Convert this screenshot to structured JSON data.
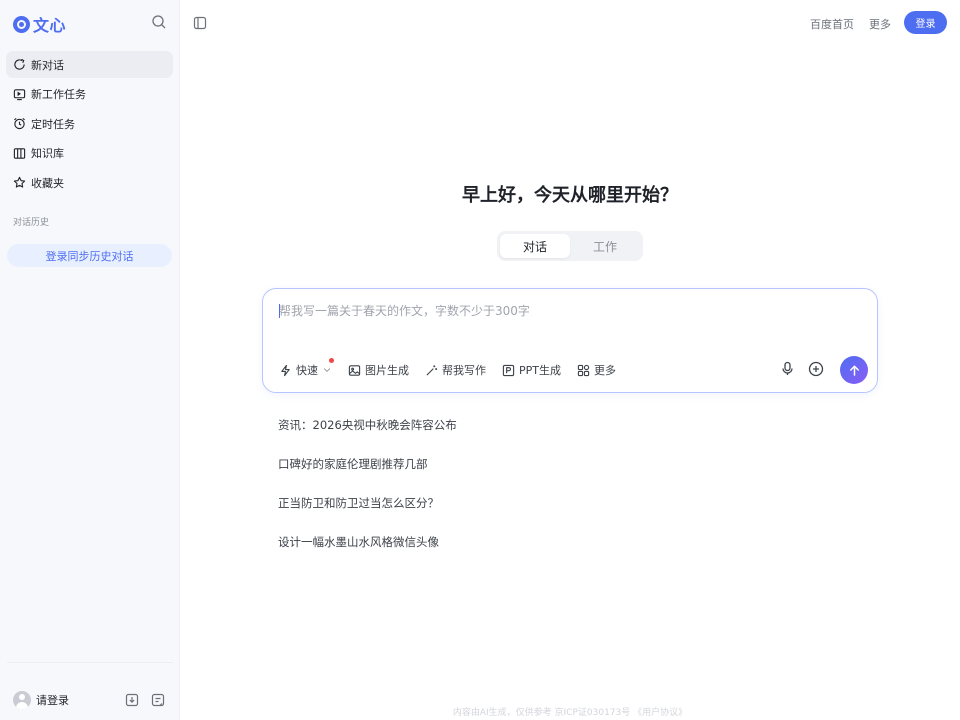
{
  "sidebar": {
    "logo_text": "文心",
    "menu": [
      {
        "label": "新对话",
        "icon": "new-chat-icon",
        "active": true
      },
      {
        "label": "新工作任务",
        "icon": "task-icon",
        "active": false
      },
      {
        "label": "定时任务",
        "icon": "alarm-clock-icon",
        "active": false
      },
      {
        "label": "知识库",
        "icon": "library-icon",
        "active": false
      },
      {
        "label": "收藏夹",
        "icon": "star-icon",
        "active": false
      }
    ],
    "history_label": "对话历史",
    "sync_button": "登录同步历史对话",
    "login_text": "请登录"
  },
  "header": {
    "links": [
      "百度首页",
      "更多"
    ],
    "login_button": "登录"
  },
  "main": {
    "greeting": "早上好，今天从哪里开始？",
    "modes": [
      "对话",
      "工作"
    ],
    "active_mode": "对话",
    "input_placeholder": "帮我写一篇关于春天的作文，字数不少于300字",
    "tools": [
      "快速",
      "图片生成",
      "帮我写作",
      "PPT生成",
      "更多"
    ],
    "suggestions": [
      "资讯：2026央视中秋晚会阵容公布",
      "口碑好的家庭伦理剧推荐几部",
      "正当防卫和防卫过当怎么区分？",
      "设计一幅水墨山水风格微信头像"
    ]
  },
  "footer": "内容由AI生成，仅供参考  京ICP证030173号  《用户协议》",
  "colors": {
    "accent": "#4e6ef2",
    "sidebar_bg": "#f7f8fb",
    "sync_bg": "#e8efff",
    "notice_dot": "#f04848"
  }
}
